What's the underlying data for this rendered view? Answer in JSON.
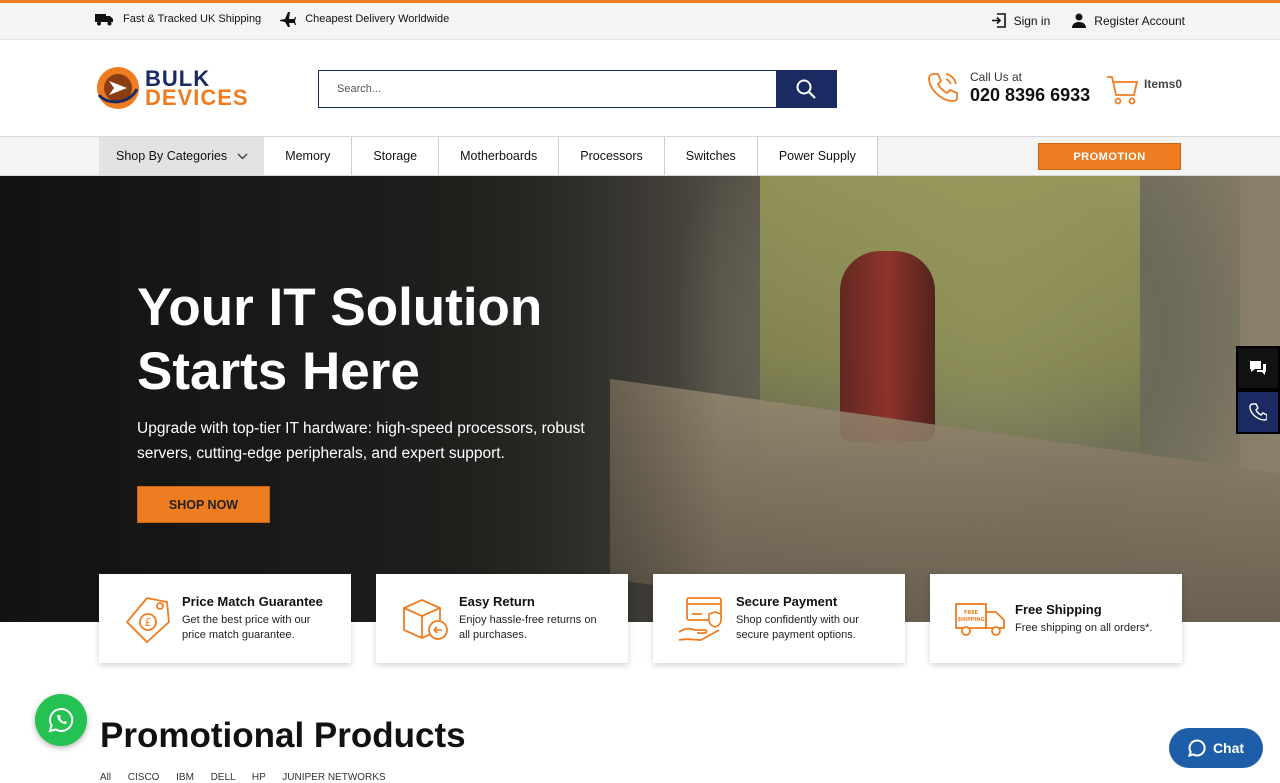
{
  "topbar": {
    "shipping_uk": "Fast & Tracked UK Shipping",
    "shipping_world": "Cheapest Delivery Worldwide",
    "sign_in": "Sign in",
    "register": "Register Account"
  },
  "header": {
    "logo_line1": "BULK",
    "logo_line2": "DEVICES",
    "search_placeholder": "Search...",
    "call_label": "Call Us at",
    "phone": "020 8396 6933",
    "cart_label": "Items",
    "cart_count": "0"
  },
  "nav": {
    "categories": "Shop By Categories",
    "items": [
      "Memory",
      "Storage",
      "Motherboards",
      "Processors",
      "Switches",
      "Power Supply"
    ],
    "promotion": "PROMOTION"
  },
  "hero": {
    "title": "Your IT Solution Starts Here",
    "subtitle": "Upgrade with top-tier IT hardware: high-speed processors, robust servers, cutting-edge peripherals, and expert support.",
    "cta": "SHOP NOW"
  },
  "features": [
    {
      "title": "Price Match Guarantee",
      "desc": "Get the best price with our price match guarantee.",
      "icon": "price-tag-icon"
    },
    {
      "title": "Easy Return",
      "desc": "Enjoy hassle-free returns on all purchases.",
      "icon": "return-box-icon"
    },
    {
      "title": "Secure Payment",
      "desc": "Shop confidently with our secure payment options.",
      "icon": "secure-payment-icon"
    },
    {
      "title": "Free Shipping",
      "desc": "Free shipping on all orders*.",
      "icon": "delivery-truck-icon"
    }
  ],
  "promo": {
    "title": "Promotional Products",
    "brands": "All      CISCO      IBM      DELL      HP      JUNIPER NETWORKS"
  },
  "chat": {
    "label": "Chat"
  },
  "colors": {
    "accent": "#ee7d22",
    "navy": "#1c2a62",
    "whatsapp": "#25c253",
    "chat": "#1d5ea8"
  }
}
